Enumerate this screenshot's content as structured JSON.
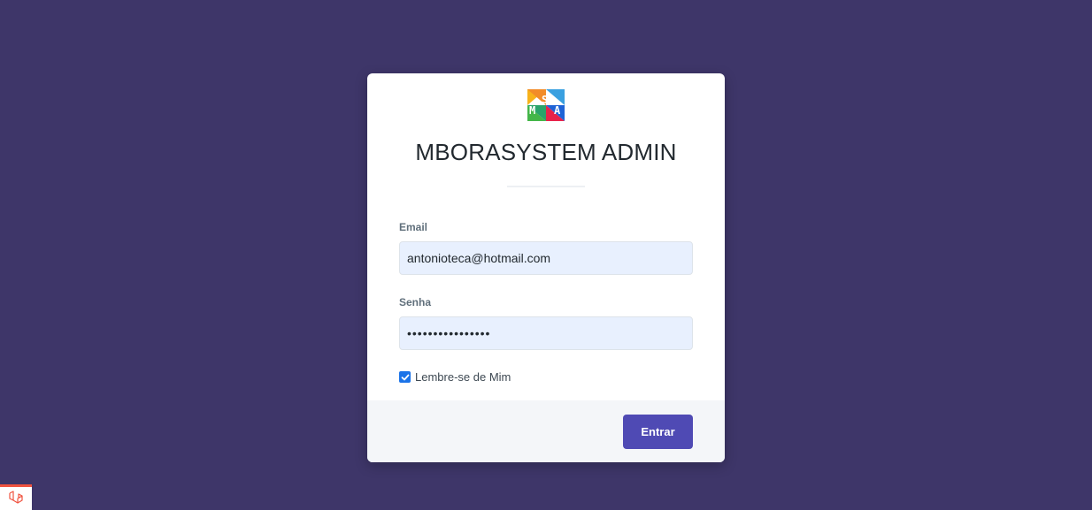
{
  "app": {
    "title": "MBORASYSTEM ADMIN",
    "logo_letters": "MSA"
  },
  "form": {
    "email_label": "Email",
    "email_value": "antonioteca@hotmail.com",
    "password_label": "Senha",
    "password_value": "••••••••••••••••",
    "remember_label": "Lembre-se de Mim",
    "remember_checked": true,
    "submit_label": "Entrar"
  },
  "colors": {
    "background": "#3e3669",
    "button": "#4f4ab4",
    "input_autofill": "#e8f0fe",
    "checkbox": "#1a73e8",
    "badge_accent": "#f05340"
  },
  "icons": {
    "logo": "msa-logo",
    "check": "check-icon",
    "badge": "laravel-icon"
  }
}
